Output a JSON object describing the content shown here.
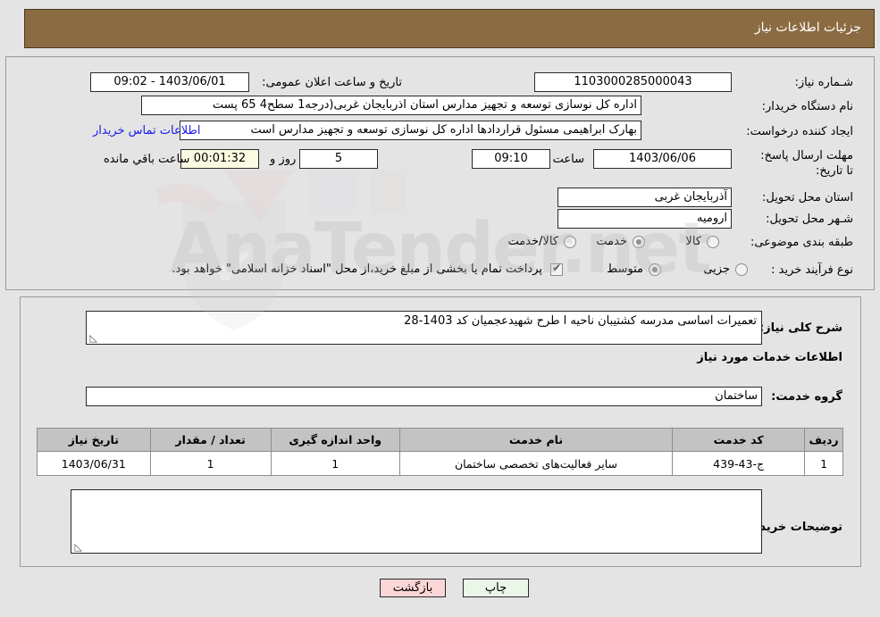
{
  "header": {
    "title": "جزئیات اطلاعات نیاز"
  },
  "form": {
    "need_number_label": "شـماره نیاز:",
    "need_number_value": "1103000285000043",
    "announce_label": "تاریخ و ساعت اعلان عمومی:",
    "announce_value": "1403/06/01 - 09:02",
    "buyer_org_label": "نام دستگاه خریدار:",
    "buyer_org_value": "اداره کل نوسازی   توسعه و تجهیز مدارس استان اذربایجان غربی(درجه1  سطح4  65 پست",
    "creator_label": "ایجاد کننده درخواست:",
    "creator_value": "بهارک ابراهیمی مسئول قراردادها اداره کل نوسازی   توسعه و تجهیز مدارس است",
    "contact_link": "اطلاعات تماس خریدار",
    "deadline_label": "مهلت ارسال پاسخ: تا تاریخ:",
    "deadline_date": "1403/06/06",
    "deadline_hour_label": "ساعت",
    "deadline_hour": "09:10",
    "days_value": "5",
    "days_label": "روز و",
    "timer_value": "00:01:32",
    "timer_label": "ساعت باقي مانده",
    "province_label": "استان محل تحویل:",
    "province_value": "آذربایجان غربی",
    "city_label": "شـهر محل تحویل:",
    "city_value": "ارومیه",
    "category_label": "طبقه بندی موضوعی:",
    "category_options": [
      {
        "label": "کالا",
        "selected": false
      },
      {
        "label": "خدمت",
        "selected": true
      },
      {
        "label": "کالا/خدمت",
        "selected": false
      }
    ],
    "process_label": "نوع فرآیند خرید :",
    "process_options": [
      {
        "label": "جزیی",
        "selected": false
      },
      {
        "label": "متوسط",
        "selected": true
      }
    ],
    "treasury_checkbox_checked": true,
    "treasury_text": "پرداخت تمام یا بخشی از مبلغ خرید،از محل \"اسناد خزانه اسلامی\" خواهد بود."
  },
  "details": {
    "summary_label": "شرح کلی نیاز:",
    "summary_value": "تعمیرات اساسی مدرسه کشتیبان ناحیه ا طرح شهیدعجمیان کد 1403-28",
    "services_heading": "اطلاعات خدمات مورد نیاز",
    "service_group_label": "گروه خدمت:",
    "service_group_value": "ساختمان",
    "buyer_notes_label": "توضیحات خریدار:",
    "buyer_notes_value": ""
  },
  "table": {
    "headers": [
      "ردیف",
      "کد خدمت",
      "نام خدمت",
      "واحد اندازه گیری",
      "تعداد / مقدار",
      "تاریخ نیاز"
    ],
    "rows": [
      {
        "row": "1",
        "service_code": "ج-43-439",
        "service_name": "سایر فعالیت‌های تخصصی ساختمان",
        "unit": "1",
        "quantity": "1",
        "need_date": "1403/06/31"
      }
    ]
  },
  "buttons": {
    "print": "چاپ",
    "back": "بازگشت"
  },
  "watermark": {
    "text": "AnaTender.net"
  },
  "colors": {
    "header_bg": "#8b6b42",
    "panel_bg": "#e4e4e4",
    "link": "#1a1aee",
    "timer_bg": "#fbfbe2",
    "print_btn": "#eaf7e8",
    "back_btn": "#fbd6d6"
  }
}
